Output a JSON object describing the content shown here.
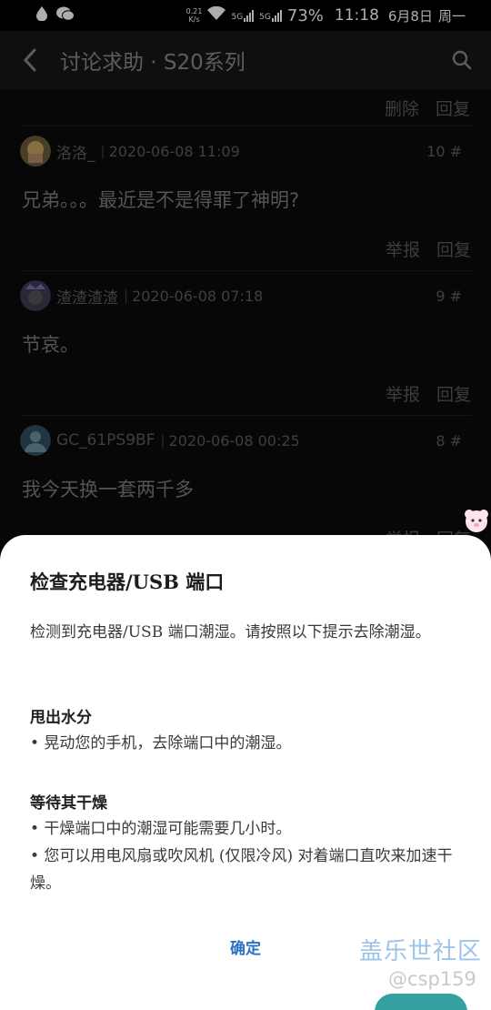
{
  "status_bar": {
    "speed_value": "0.21",
    "speed_unit": "K/s",
    "sim1": "5G",
    "sim2": "5G",
    "battery": "73%",
    "time": "11:18",
    "date": "6月8日",
    "weekday": "周一"
  },
  "header": {
    "title": "讨论求助 · S20系列"
  },
  "top_actions": [
    "删除",
    "回复"
  ],
  "comments": [
    {
      "user": "洛洛_",
      "time": "2020-06-08 11:09",
      "floor": "10 #",
      "text": "兄弟。。。最近是不是得罪了神明?",
      "actions": [
        "举报",
        "回复"
      ]
    },
    {
      "user": "渣渣渣渣",
      "time": "2020-06-08 07:18",
      "floor": "9 #",
      "text": "节哀。",
      "actions": [
        "举报",
        "回复"
      ]
    },
    {
      "user": "GC_61PS9BF",
      "time": "2020-06-08 00:25",
      "floor": "8 #",
      "text": "我今天换一套两千多",
      "actions": [
        "举报",
        "回复"
      ]
    }
  ],
  "dialog": {
    "title": "检查充电器/USB 端口",
    "intro": "检测到充电器/USB 端口潮湿。请按照以下提示去除潮湿。",
    "section1_title": "甩出水分",
    "section1_bullet": "• 晃动您的手机，去除端口中的潮湿。",
    "section2_title": "等待其干燥",
    "section2_bullet1": "• 干燥端口中的潮湿可能需要几小时。",
    "section2_bullet2": "• 您可以用电风扇或吹风机 (仅限冷风) 对着端口直吹来加速干燥。",
    "confirm": "确定"
  },
  "watermark": {
    "site": "盖乐世社区",
    "user": "@csp159"
  },
  "colors": {
    "dialog_button": "#2d6fc4",
    "header_bg": "#171717",
    "page_bg": "#0b0b0b"
  }
}
